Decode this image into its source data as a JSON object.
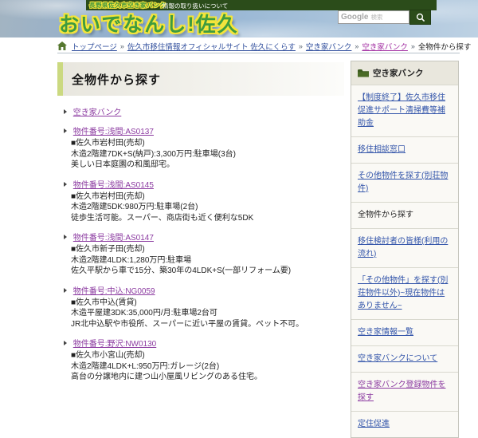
{
  "header": {
    "top_bar": {
      "site_label": "長野県佐久市空き家バンク",
      "info_link": "情報の取り扱いについて"
    },
    "logo": "おいでなんし!佐久",
    "search": {
      "brand": "Google",
      "placeholder_suffix": "検索"
    },
    "colors": {
      "bar_green": "#2b4c1a",
      "logo_green": "#3f9b3f",
      "logo_outline_yellow": "#f5e53a"
    }
  },
  "breadcrumb": {
    "separator": "»",
    "items": [
      {
        "label": "トップページ",
        "state": "link"
      },
      {
        "label": "佐久市移住情報オフィシャルサイト 佐久にくらす",
        "state": "link"
      },
      {
        "label": "空き家バンク",
        "state": "link"
      },
      {
        "label": "空き家バンク",
        "state": "visited"
      },
      {
        "label": "全物件から探す",
        "state": "current"
      }
    ]
  },
  "main": {
    "title": "全物件から探す",
    "intro_link": "空き家バンク",
    "listings": [
      {
        "id": "物件番号:浅間:AS0137",
        "location": "■佐久市岩村田(売却)",
        "spec": "木造2階建7DK+S(納戸):3,300万円:駐車場(3台)",
        "description": "美しい日本庭園の和風邸宅。"
      },
      {
        "id": "物件番号:浅間:AS0145",
        "location": "■佐久市岩村田(売却)",
        "spec": "木造2階建5DK:980万円:駐車場(2台)",
        "description": "徒歩生活可能。スーパー、商店街も近く便利な5DK"
      },
      {
        "id": "物件番号:浅間:AS0147",
        "location": "■佐久市新子田(売却)",
        "spec": "木造2階建4LDK:1,280万円:駐車場",
        "description": "佐久平駅から車で15分、築30年の4LDK+S(一部リフォーム要)"
      },
      {
        "id": "物件番号:中込:NG0059",
        "location": "■佐久市中込(賃貸)",
        "spec": "木造平屋建3DK:35,000円/月:駐車場2台可",
        "description": "JR北中込駅や市役所、スーパーに近い平屋の賃貸。ペット不可。"
      },
      {
        "id": "物件番号:野沢:NW0130",
        "location": "■佐久市小宮山(売却)",
        "spec": "木造2階建4LDK+L:950万円:ガレージ(2台)",
        "description": "高台の分譲地内に建つ山小屋風リビングのある住宅。"
      }
    ]
  },
  "sidebar": {
    "title": "空き家バンク",
    "items": [
      {
        "label": "【制度終了】佐久市移住促進サポート清掃費等補助金",
        "state": "link"
      },
      {
        "label": "移住相談窓口",
        "state": "link"
      },
      {
        "label": "その他物件を探す(別荘物件)",
        "state": "link"
      },
      {
        "label": "全物件から探す",
        "state": "current"
      },
      {
        "label": "移住検討者の皆様(利用の流れ)",
        "state": "link"
      },
      {
        "label": "「その他物件」を探す(別荘物件以外)~現在物件はありません~",
        "state": "link"
      },
      {
        "label": "空き家情報一覧",
        "state": "link"
      },
      {
        "label": "空き家バンクについて",
        "state": "link"
      },
      {
        "label": "空き家バンク登録物件を探す",
        "state": "visited"
      },
      {
        "label": "定住促進",
        "state": "link"
      }
    ]
  }
}
